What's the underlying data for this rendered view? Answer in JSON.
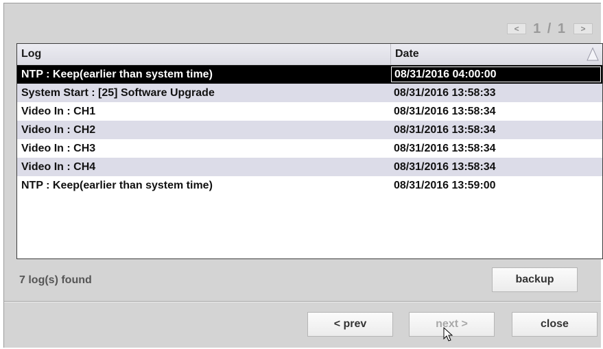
{
  "pager": {
    "prev_icon": "<",
    "next_icon": ">",
    "page_text": "1 / 1"
  },
  "table": {
    "columns": {
      "log": "Log",
      "date": "Date"
    },
    "sort_icon": "sort-triangle-icon",
    "rows": [
      {
        "log": "NTP : Keep(earlier than system time)",
        "date": "08/31/2016 04:00:00",
        "selected": true
      },
      {
        "log": "System Start : [25] Software Upgrade",
        "date": "08/31/2016 13:58:33"
      },
      {
        "log": "Video In : CH1",
        "date": "08/31/2016 13:58:34"
      },
      {
        "log": "Video In : CH2",
        "date": "08/31/2016 13:58:34"
      },
      {
        "log": "Video In : CH3",
        "date": "08/31/2016 13:58:34"
      },
      {
        "log": "Video In : CH4",
        "date": "08/31/2016 13:58:34"
      },
      {
        "log": "NTP : Keep(earlier than system time)",
        "date": "08/31/2016 13:59:00"
      }
    ]
  },
  "status": {
    "found_text": "7 log(s) found"
  },
  "buttons": {
    "backup": "backup",
    "prev": "< prev",
    "next": "next >",
    "close": "close"
  },
  "colors": {
    "dialog_bg": "#d4d4d4",
    "selected_row": "#000000",
    "alt_row": "#dcdce8"
  }
}
